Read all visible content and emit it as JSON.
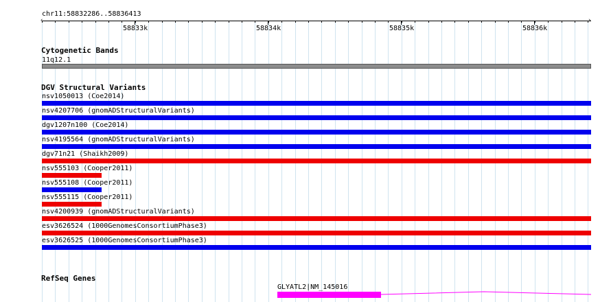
{
  "region": "chr11:58832286..58836413",
  "ruler": {
    "ticks": [
      "58833k",
      "58834k",
      "58835k",
      "58836k"
    ]
  },
  "tracks": {
    "cytogenetic_bands": {
      "title": "Cytogenetic Bands",
      "band_label": "11q12.1",
      "band_color": "#8c8c8c"
    },
    "dgv": {
      "title": "DGV Structural Variants",
      "gain_color": "#0000ee",
      "loss_color": "#ee0000",
      "features": [
        {
          "label": "nsv1050013 (Coe2014)",
          "color": "#0000ee"
        },
        {
          "label": "nsv4207706 (gnomADStructuralVariants)",
          "color": "#0000ee"
        },
        {
          "label": "dgv1207n100 (Coe2014)",
          "color": "#0000ee"
        },
        {
          "label": "nsv4195564 (gnomADStructuralVariants)",
          "color": "#0000ee"
        },
        {
          "label": "dgv71n21 (Shaikh2009)",
          "color": "#ee0000"
        },
        {
          "label": "nsv555103 (Cooper2011)",
          "color": "#ee0000"
        },
        {
          "label": "nsv555108 (Cooper2011)",
          "color": "#0000ee"
        },
        {
          "label": "nsv555115 (Cooper2011)",
          "color": "#ee0000"
        },
        {
          "label": "nsv4200939 (gnomADStructuralVariants)",
          "color": "#ee0000"
        },
        {
          "label": "esv3626524 (1000GenomesConsortiumPhase3)",
          "color": "#ee0000"
        },
        {
          "label": "esv3626525 (1000GenomesConsortiumPhase3)",
          "color": "#0000ee"
        }
      ]
    },
    "refseq": {
      "title": "RefSeq Genes",
      "gene_label": "GLYATL2|NM_145016",
      "gene_color": "#ff00ff"
    }
  }
}
